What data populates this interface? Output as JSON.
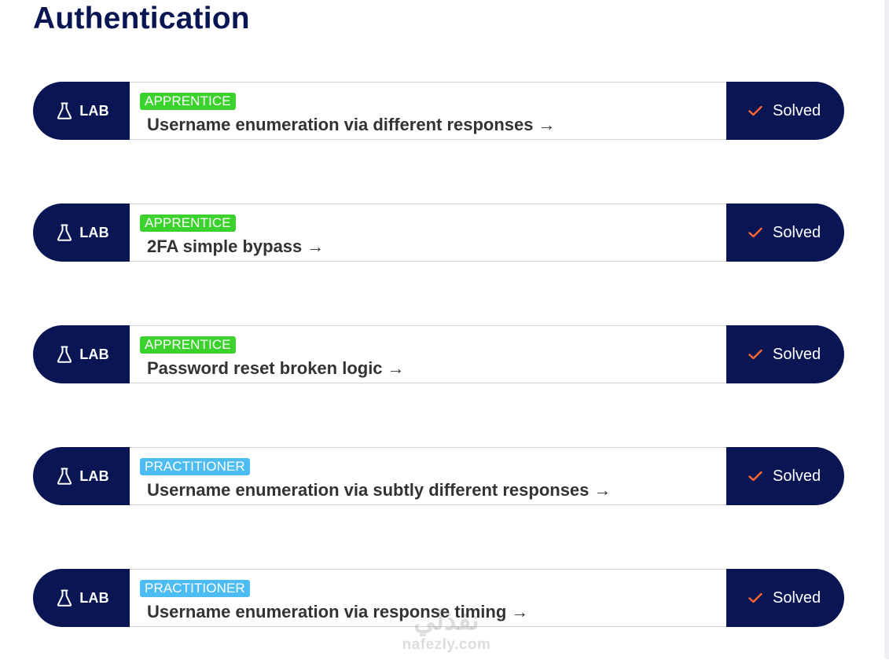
{
  "title": "Authentication",
  "labs": [
    {
      "badge": "LAB",
      "level": "APPRENTICE",
      "level_color": "#3cd22d",
      "name": "Username enumeration via different responses",
      "arrow": "→",
      "status": "Solved"
    },
    {
      "badge": "LAB",
      "level": "APPRENTICE",
      "level_color": "#3cd22d",
      "name": "2FA simple bypass",
      "arrow": "→",
      "status": "Solved"
    },
    {
      "badge": "LAB",
      "level": "APPRENTICE",
      "level_color": "#3cd22d",
      "name": "Password reset broken logic",
      "arrow": "→",
      "status": "Solved"
    },
    {
      "badge": "LAB",
      "level": "PRACTITIONER",
      "level_color": "#4cbcf2",
      "name": "Username enumeration via subtly different responses",
      "arrow": "→",
      "status": "Solved"
    },
    {
      "badge": "LAB",
      "level": "PRACTITIONER",
      "level_color": "#4cbcf2",
      "name": "Username enumeration via response timing",
      "arrow": "→",
      "status": "Solved"
    }
  ],
  "colors": {
    "navy": "#0a1654",
    "check": "#ff6633",
    "apprentice": "#3cd22d",
    "practitioner": "#4cbcf2"
  },
  "icons": {
    "badge_icon": "flask-icon",
    "status_icon": "checkmark-icon"
  },
  "watermark": {
    "arabic": "نفذلي",
    "latin": "nafezly.com"
  }
}
